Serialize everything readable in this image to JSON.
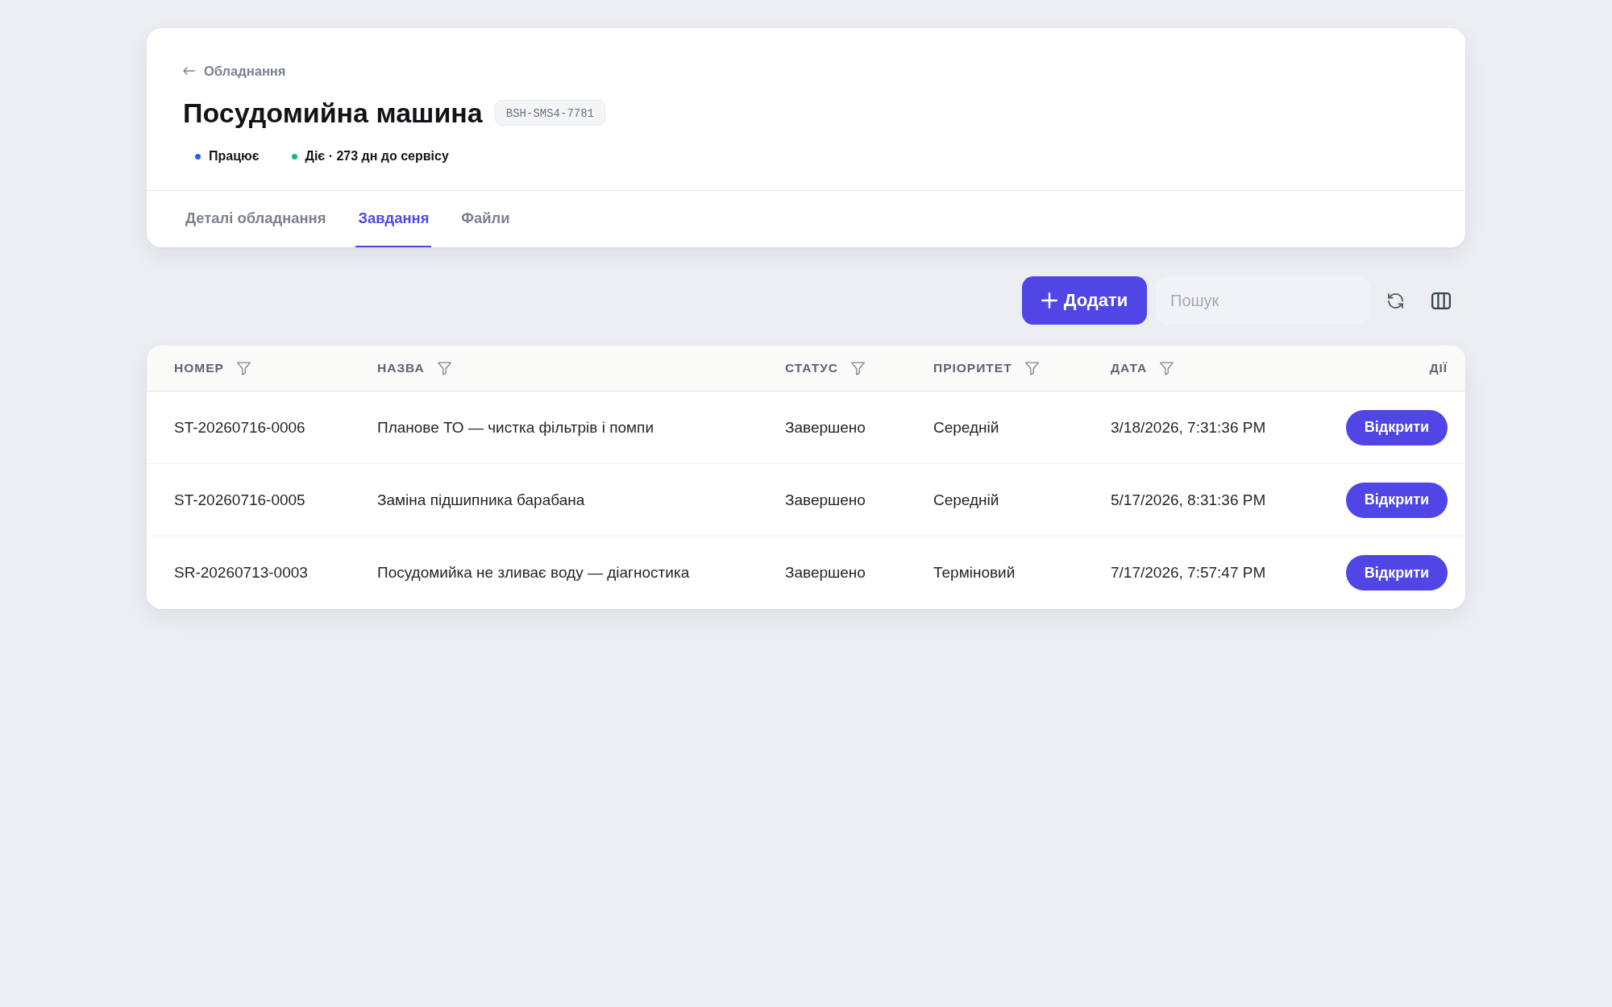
{
  "header": {
    "back_link": "Обладнання",
    "title": "Посудомийна машина",
    "code_badge": "BSH-SMS4-7781",
    "statuses": [
      {
        "label": "Працює",
        "color": "#2563eb"
      },
      {
        "label": "Діє · 273 дн до сервісу",
        "color": "#10b981"
      }
    ]
  },
  "tabs": [
    {
      "label": "Деталі обладнання",
      "selected": false
    },
    {
      "label": "Завдання",
      "selected": true
    },
    {
      "label": "Файли",
      "selected": false
    }
  ],
  "toolbar": {
    "add_button": "Додати",
    "search": {
      "placeholder": "Пошук"
    }
  },
  "table": {
    "columns": [
      {
        "label": "НОМЕР",
        "filterable": true
      },
      {
        "label": "НАЗВА",
        "filterable": true
      },
      {
        "label": "СТАТУС",
        "filterable": true
      },
      {
        "label": "ПРІОРИТЕТ",
        "filterable": true
      },
      {
        "label": "ДАТА",
        "filterable": true
      },
      {
        "label": "ДІЇ",
        "filterable": false
      }
    ],
    "rows": [
      {
        "number": "ST-20260716-0006",
        "name": "Планове ТО — чистка фільтрів і помпи",
        "status": "Завершено",
        "priority": "Середній",
        "date": "3/18/2026, 7:31:36 PM",
        "action": "Відкрити"
      },
      {
        "number": "ST-20260716-0005",
        "name": "Заміна підшипника барабана",
        "status": "Завершено",
        "priority": "Середній",
        "date": "5/17/2026, 8:31:36 PM",
        "action": "Відкрити"
      },
      {
        "number": "SR-20260713-0003",
        "name": "Посудомийка не зливає воду — діагностика",
        "status": "Завершено",
        "priority": "Терміновий",
        "date": "7/17/2026, 7:57:47 PM",
        "action": "Відкрити"
      }
    ]
  }
}
